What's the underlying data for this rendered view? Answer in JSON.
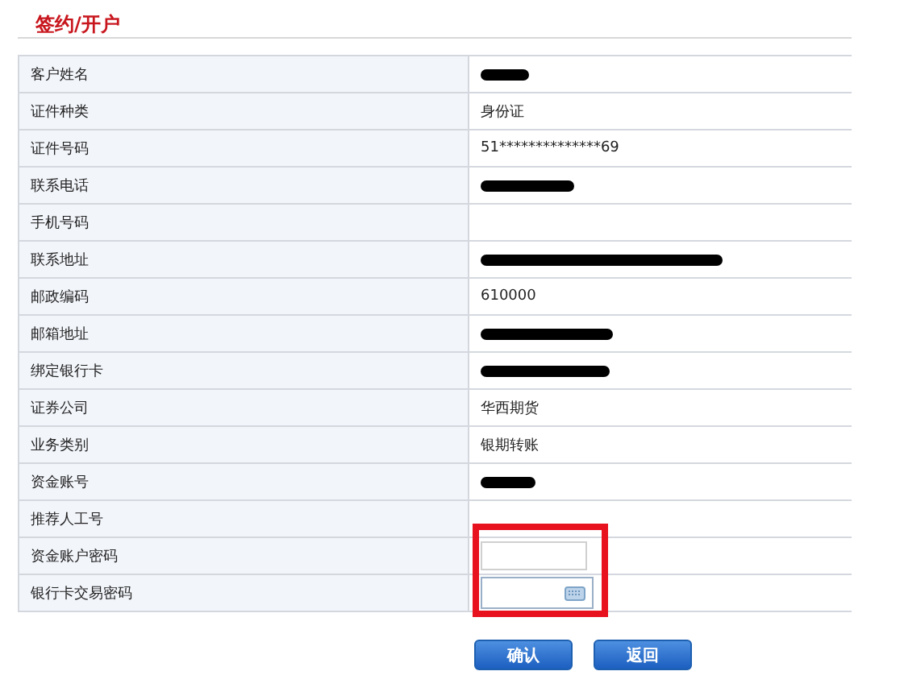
{
  "title": "签约/开户",
  "rows": [
    {
      "label": "客户姓名",
      "kind": "redacted"
    },
    {
      "label": "证件种类",
      "kind": "text",
      "value": "身份证"
    },
    {
      "label": "证件号码",
      "kind": "text",
      "value": "51**************69"
    },
    {
      "label": "联系电话",
      "kind": "redacted"
    },
    {
      "label": "手机号码",
      "kind": "empty"
    },
    {
      "label": "联系地址",
      "kind": "redacted"
    },
    {
      "label": "邮政编码",
      "kind": "text",
      "value": "610000"
    },
    {
      "label": "邮箱地址",
      "kind": "redacted"
    },
    {
      "label": "绑定银行卡",
      "kind": "redacted"
    },
    {
      "label": "证券公司",
      "kind": "text",
      "value": "华西期货"
    },
    {
      "label": "业务类别",
      "kind": "text",
      "value": "银期转账"
    },
    {
      "label": "资金账号",
      "kind": "redacted"
    },
    {
      "label": "推荐人工号",
      "kind": "empty"
    },
    {
      "label": "资金账户密码",
      "kind": "password",
      "highlighted": true
    },
    {
      "label": "银行卡交易密码",
      "kind": "keyboard-password",
      "highlighted": true
    }
  ],
  "buttons": [
    "确认",
    "返回"
  ]
}
